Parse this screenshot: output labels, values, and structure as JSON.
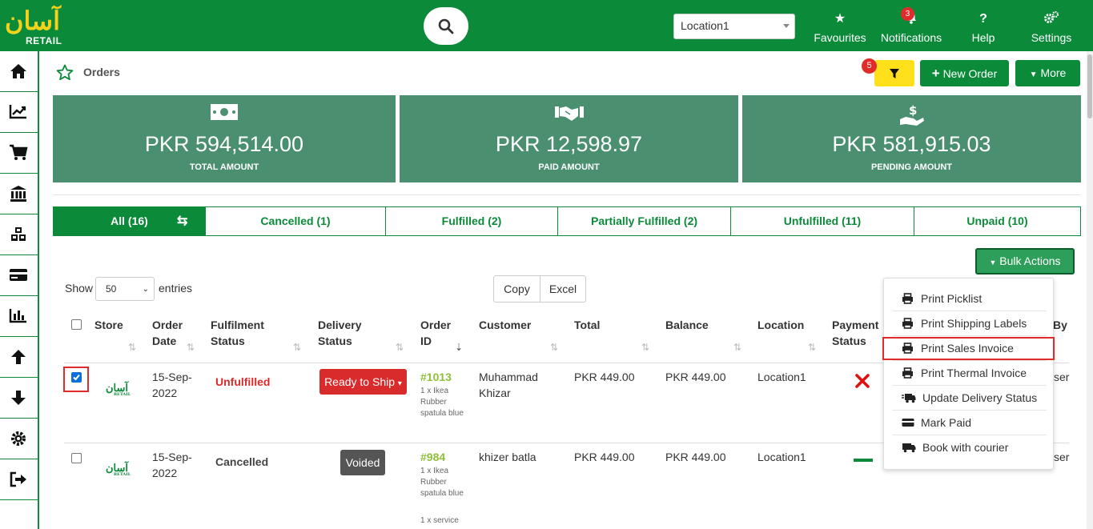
{
  "app": {
    "logo_urdu": "آسان",
    "logo_retail": "RETAIL"
  },
  "topbar": {
    "location": "Location1",
    "favourites": "Favourites",
    "notifications": "Notifications",
    "notifications_count": "3",
    "help": "Help",
    "settings": "Settings"
  },
  "page": {
    "title": "Orders",
    "filter_count": "5",
    "new_order": "New Order",
    "more": "More"
  },
  "stats": [
    {
      "amount": "PKR 594,514.00",
      "label": "TOTAL AMOUNT",
      "icon": "money-bill-icon"
    },
    {
      "amount": "PKR 12,598.97",
      "label": "PAID AMOUNT",
      "icon": "handshake-icon"
    },
    {
      "amount": "PKR 581,915.03",
      "label": "PENDING AMOUNT",
      "icon": "hand-holding-dollar-icon"
    }
  ],
  "tabs": [
    "All (16)",
    "Cancelled (1)",
    "Fulfilled (2)",
    "Partially Fulfilled (2)",
    "Unfulfilled (11)",
    "Unpaid (10)"
  ],
  "table_controls": {
    "show": "Show",
    "page_size": "50",
    "entries": "entries",
    "copy": "Copy",
    "excel": "Excel",
    "bulk_actions": "Bulk Actions"
  },
  "columns": [
    "Store",
    "Order Date",
    "Fulfilment Status",
    "Delivery Status",
    "Order ID",
    "Customer",
    "Total",
    "Balance",
    "Location",
    "Payment Status",
    "By"
  ],
  "rows": [
    {
      "checked": true,
      "store_logo": "آسان",
      "store_logo_sub": "RETAIL",
      "order_date": "15-Sep-2022",
      "fulfilment": "Unfulfilled",
      "delivery": "Ready to Ship",
      "order_id": "#1013",
      "items": "1 x Ikea Rubber spatula blue",
      "customer": "Muhammad Khizar",
      "total": "PKR 449.00",
      "balance": "PKR 449.00",
      "location": "Location1",
      "payment_status": "unpaid",
      "by": "ser"
    },
    {
      "checked": false,
      "store_logo": "آسان",
      "store_logo_sub": "RETAIL",
      "order_date": "15-Sep-2022",
      "fulfilment": "Cancelled",
      "delivery": "Voided",
      "order_id": "#984",
      "items": "1 x Ikea Rubber spatula blue",
      "items2": "1 x service",
      "customer": "khizer batla",
      "total": "PKR 449.00",
      "balance": "PKR 449.00",
      "location": "Location1",
      "payment_status": "none",
      "by": "ser"
    }
  ],
  "bulk_menu": [
    {
      "label": "Print Picklist",
      "icon": "print-icon"
    },
    {
      "label": "Print Shipping Labels",
      "icon": "print-icon"
    },
    {
      "label": "Print Sales Invoice",
      "icon": "print-icon",
      "highlighted": true
    },
    {
      "label": "Print Thermal Invoice",
      "icon": "print-icon"
    },
    {
      "label": "Update Delivery Status",
      "icon": "truck-fast-icon"
    },
    {
      "label": "Mark Paid",
      "icon": "credit-card-icon"
    },
    {
      "label": "Book with courier",
      "icon": "truck-icon"
    }
  ],
  "colors": {
    "brand_green": "#0b8a3a",
    "stat_green": "#4a8f70",
    "danger_red": "#d92b2b",
    "filter_yellow": "#ffe01a",
    "order_id_green": "#8fbf3a"
  }
}
